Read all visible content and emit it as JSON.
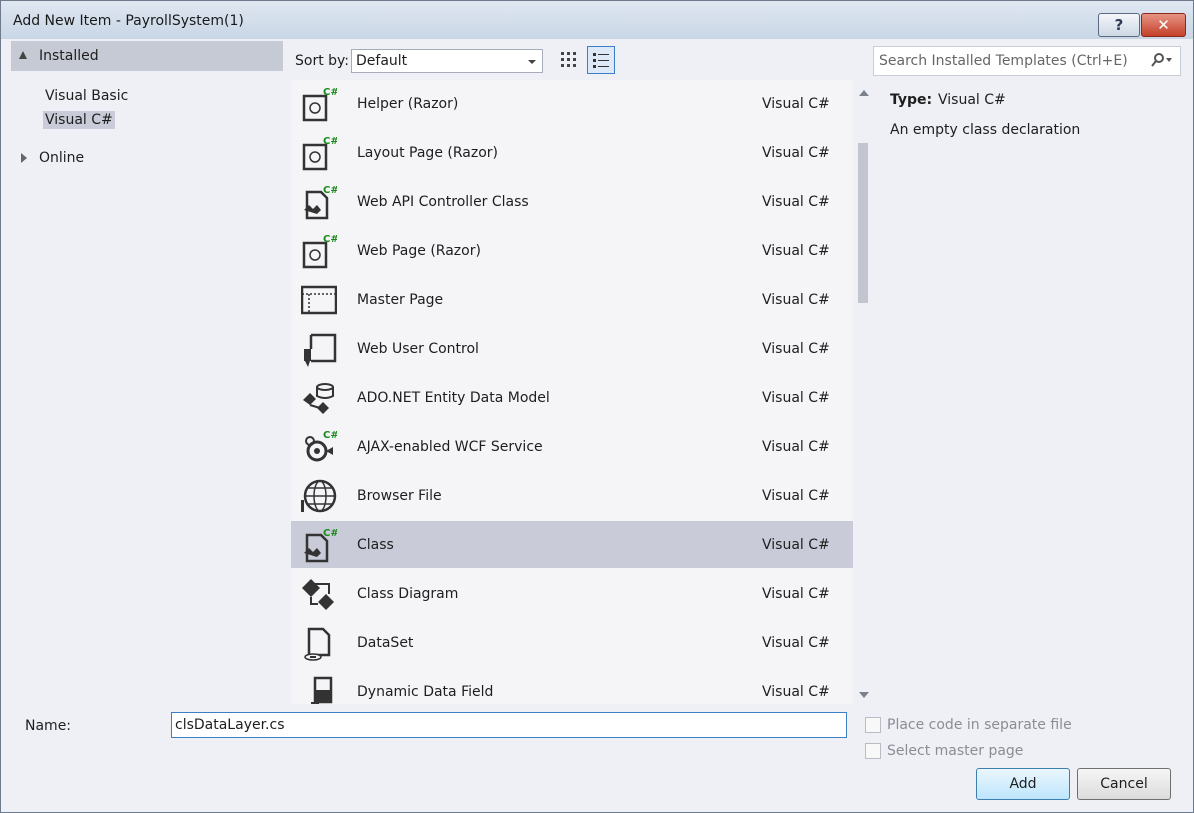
{
  "window": {
    "title": "Add New Item - PayrollSystem(1)",
    "help_label": "?",
    "close_label": "✕"
  },
  "left_pane": {
    "installed_label": "Installed",
    "items": [
      {
        "label": "Visual Basic"
      },
      {
        "label": "Visual C#"
      }
    ],
    "online_label": "Online"
  },
  "toolbar": {
    "sort_label": "Sort by:",
    "sort_value": "Default"
  },
  "search": {
    "placeholder": "Search Installed Templates (Ctrl+E)"
  },
  "templates": [
    {
      "name": "Helper (Razor)",
      "lang": "Visual C#",
      "icon": "razor-helper-icon"
    },
    {
      "name": "Layout Page (Razor)",
      "lang": "Visual C#",
      "icon": "razor-layout-icon"
    },
    {
      "name": "Web API Controller Class",
      "lang": "Visual C#",
      "icon": "web-api-controller-icon"
    },
    {
      "name": "Web Page (Razor)",
      "lang": "Visual C#",
      "icon": "razor-webpage-icon"
    },
    {
      "name": "Master Page",
      "lang": "Visual C#",
      "icon": "master-page-icon"
    },
    {
      "name": "Web User Control",
      "lang": "Visual C#",
      "icon": "web-user-control-icon"
    },
    {
      "name": "ADO.NET Entity Data Model",
      "lang": "Visual C#",
      "icon": "entity-data-model-icon"
    },
    {
      "name": "AJAX-enabled WCF Service",
      "lang": "Visual C#",
      "icon": "wcf-service-icon"
    },
    {
      "name": "Browser File",
      "lang": "Visual C#",
      "icon": "browser-file-icon"
    },
    {
      "name": "Class",
      "lang": "Visual C#",
      "icon": "class-icon"
    },
    {
      "name": "Class Diagram",
      "lang": "Visual C#",
      "icon": "class-diagram-icon"
    },
    {
      "name": "DataSet",
      "lang": "Visual C#",
      "icon": "dataset-icon"
    },
    {
      "name": "Dynamic Data Field",
      "lang": "Visual C#",
      "icon": "dynamic-data-field-icon"
    }
  ],
  "details": {
    "type_label": "Type:",
    "type_value": "Visual C#",
    "description": "An empty class declaration"
  },
  "bottom": {
    "name_label": "Name:",
    "name_value": "clsDataLayer.cs",
    "place_code_label": "Place code in separate file",
    "master_page_label": "Select master page",
    "add_label": "Add",
    "cancel_label": "Cancel"
  },
  "colors": {
    "selection": "#c9ccd8",
    "accent": "#3d7ec9",
    "csharp_badge": "#1a8a1a"
  }
}
